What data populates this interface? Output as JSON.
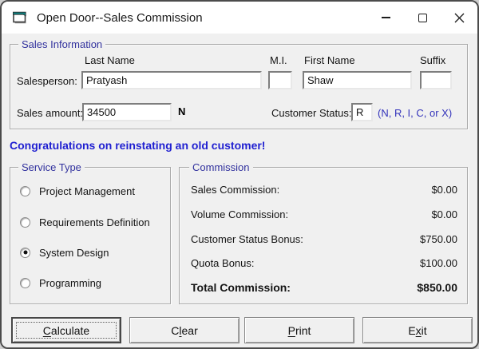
{
  "titlebar": {
    "title": "Open Door--Sales Commission",
    "icons": {
      "app": "vb-form-icon",
      "minimize": "minimize-icon",
      "maximize": "maximize-icon",
      "close": "close-icon"
    }
  },
  "sales_info": {
    "group_label": "Sales Information",
    "salesperson_label": "Salesperson:",
    "columns": {
      "last_name": "Last Name",
      "mi": "M.I.",
      "first_name": "First Name",
      "suffix": "Suffix"
    },
    "values": {
      "last_name": "Pratyash",
      "mi": "",
      "first_name": "Shaw",
      "suffix": ""
    },
    "sales_amount_label": "Sales amount:",
    "sales_amount": "34500",
    "flag": "N",
    "customer_status_label": "Customer Status:",
    "customer_status": "R",
    "status_hint": "(N, R, I, C, or X)"
  },
  "message": "Congratulations on reinstating an old customer!",
  "service_type": {
    "group_label": "Service Type",
    "options": [
      {
        "label": "Project Management",
        "selected": false
      },
      {
        "label": "Requirements Definition",
        "selected": false
      },
      {
        "label": "System Design",
        "selected": true
      },
      {
        "label": "Programming",
        "selected": false
      }
    ]
  },
  "commission": {
    "group_label": "Commission",
    "rows": [
      {
        "label": "Sales Commission:",
        "value": "$0.00",
        "bold": false
      },
      {
        "label": "Volume Commission:",
        "value": "$0.00",
        "bold": false
      },
      {
        "label": "Customer Status Bonus:",
        "value": "$750.00",
        "bold": false
      },
      {
        "label": "Quota Bonus:",
        "value": "$100.00",
        "bold": false
      },
      {
        "label": "Total Commission:",
        "value": "$850.00",
        "bold": true
      }
    ]
  },
  "buttons": [
    {
      "pre": "",
      "accel": "C",
      "post": "alculate",
      "default": true
    },
    {
      "pre": "C",
      "accel": "l",
      "post": "ear",
      "default": false
    },
    {
      "pre": "",
      "accel": "P",
      "post": "rint",
      "default": false
    },
    {
      "pre": "E",
      "accel": "x",
      "post": "it",
      "default": false
    }
  ],
  "colors": {
    "caption_blue": "#32329e",
    "message_blue": "#1f1fd1",
    "hint_blue": "#3434bb",
    "icon_teal": "#0f7e7d"
  }
}
